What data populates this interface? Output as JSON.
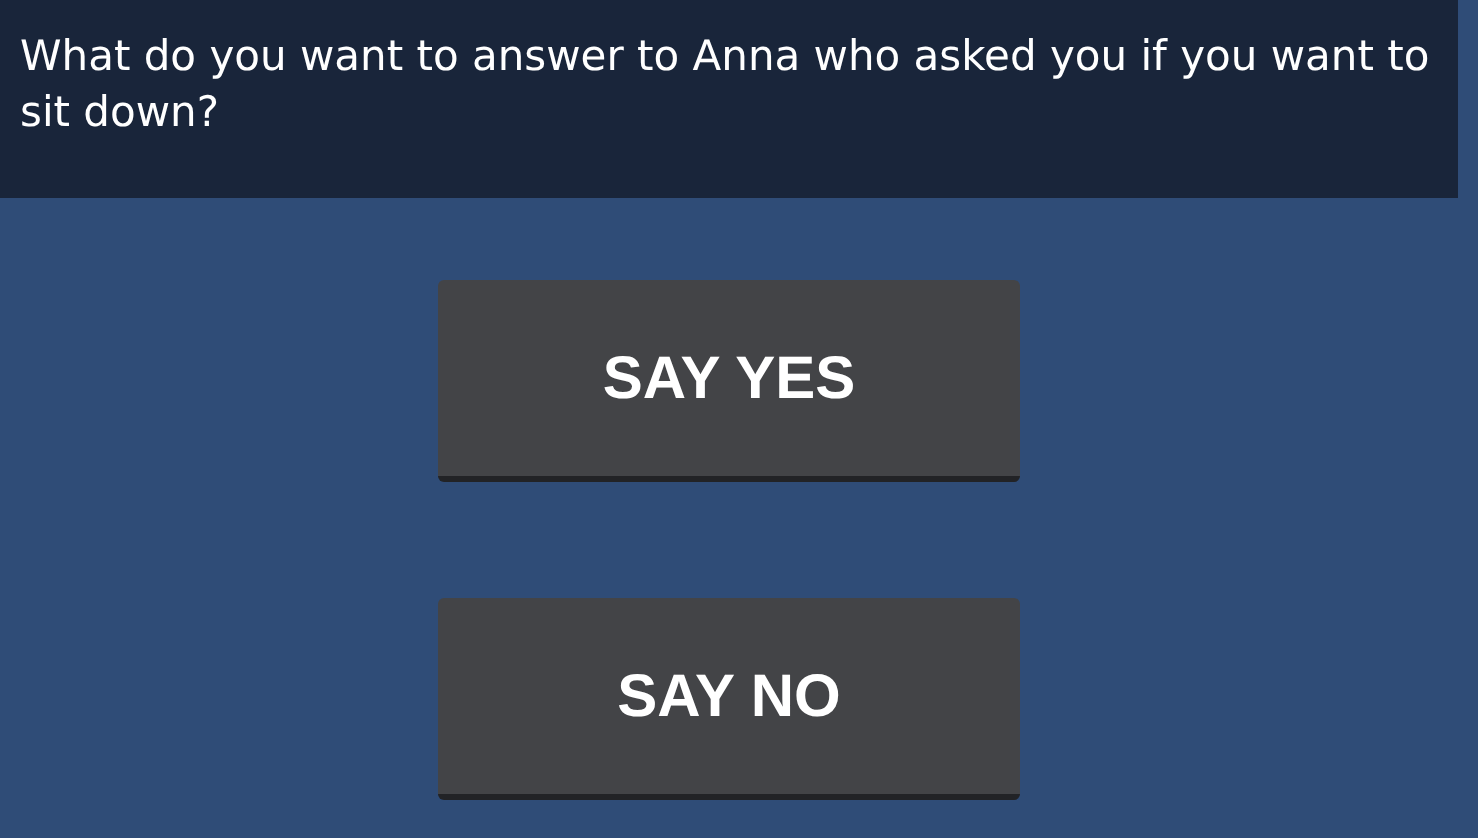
{
  "question": "What do you want to answer to Anna who asked you if you want to sit down?",
  "answers": [
    {
      "label": "SAY YES"
    },
    {
      "label": "SAY NO"
    }
  ]
}
